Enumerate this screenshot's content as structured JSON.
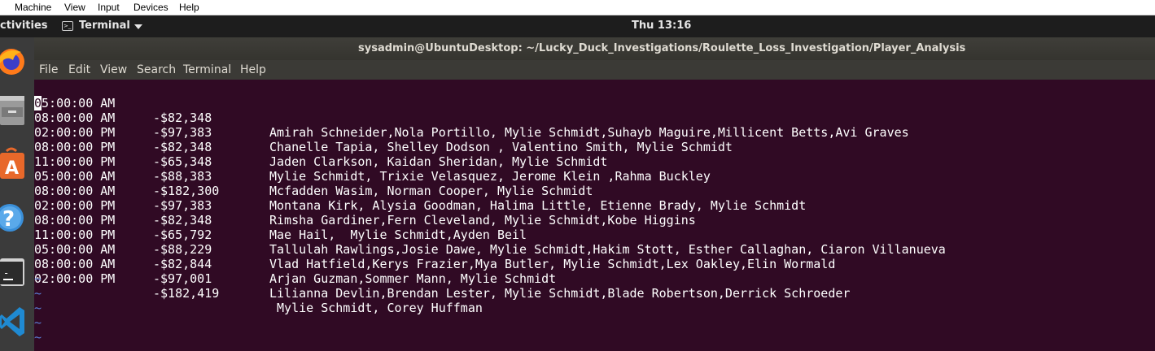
{
  "host_menubar": {
    "items": [
      "Machine",
      "View",
      "Input",
      "Devices",
      "Help"
    ]
  },
  "top_bar": {
    "activities": "ctivities",
    "app_menu_label": "Terminal",
    "clock": "Thu 13:16"
  },
  "dock": {
    "icons": [
      "firefox-icon",
      "files-icon",
      "software-icon",
      "help-icon",
      "terminal-icon",
      "vscode-icon"
    ]
  },
  "terminal": {
    "title": "sysadmin@UbuntuDesktop: ~/Lucky_Duck_Investigations/Roulette_Loss_Investigation/Player_Analysis",
    "menu": [
      "File",
      "Edit",
      "View",
      "Search",
      "Terminal",
      "Help"
    ],
    "cursor_char": "0",
    "first_time_rest": "5:00:00 AM",
    "rows": [
      {
        "time": "05:00:00 AM",
        "amount": "-$82,348",
        "players": "Amirah Schneider,Nola Portillo, Mylie Schmidt,Suhayb Maguire,Millicent Betts,Avi Graves"
      },
      {
        "time": "08:00:00 AM",
        "amount": "-$97,383",
        "players": "Chanelle Tapia, Shelley Dodson , Valentino Smith, Mylie Schmidt"
      },
      {
        "time": "02:00:00 PM",
        "amount": "-$82,348",
        "players": "Jaden Clarkson, Kaidan Sheridan, Mylie Schmidt"
      },
      {
        "time": "08:00:00 PM",
        "amount": "-$65,348",
        "players": "Mylie Schmidt, Trixie Velasquez, Jerome Klein ,Rahma Buckley"
      },
      {
        "time": "11:00:00 PM",
        "amount": "-$88,383",
        "players": "Mcfadden Wasim, Norman Cooper, Mylie Schmidt"
      },
      {
        "time": "05:00:00 AM",
        "amount": "-$182,300",
        "players": "Montana Kirk, Alysia Goodman, Halima Little, Etienne Brady, Mylie Schmidt"
      },
      {
        "time": "08:00:00 AM",
        "amount": "-$97,383",
        "players": "Rimsha Gardiner,Fern Cleveland, Mylie Schmidt,Kobe Higgins"
      },
      {
        "time": "02:00:00 PM",
        "amount": "-$82,348",
        "players": "Mae Hail,  Mylie Schmidt,Ayden Beil"
      },
      {
        "time": "08:00:00 PM",
        "amount": "-$65,792",
        "players": "Tallulah Rawlings,Josie Dawe, Mylie Schmidt,Hakim Stott, Esther Callaghan, Ciaron Villanueva"
      },
      {
        "time": "11:00:00 PM",
        "amount": "-$88,229",
        "players": "Vlad Hatfield,Kerys Frazier,Mya Butler, Mylie Schmidt,Lex Oakley,Elin Wormald"
      },
      {
        "time": "05:00:00 AM",
        "amount": "-$82,844",
        "players": "Arjan Guzman,Sommer Mann, Mylie Schmidt"
      },
      {
        "time": "08:00:00 AM",
        "amount": "-$97,001",
        "players": "Lilianna Devlin,Brendan Lester, Mylie Schmidt,Blade Robertson,Derrick Schroeder"
      },
      {
        "time": "02:00:00 PM",
        "amount": "-$182,419",
        "players": " Mylie Schmidt, Corey Huffman"
      }
    ],
    "tildes": [
      "~",
      "~",
      "~",
      "~",
      "~"
    ]
  },
  "colors": {
    "terminal_bg": "#300a24",
    "vi_tilde": "#5b7fd6",
    "dock_bg": "#3b3b3b",
    "top_bar_bg": "#1d1d1d"
  }
}
